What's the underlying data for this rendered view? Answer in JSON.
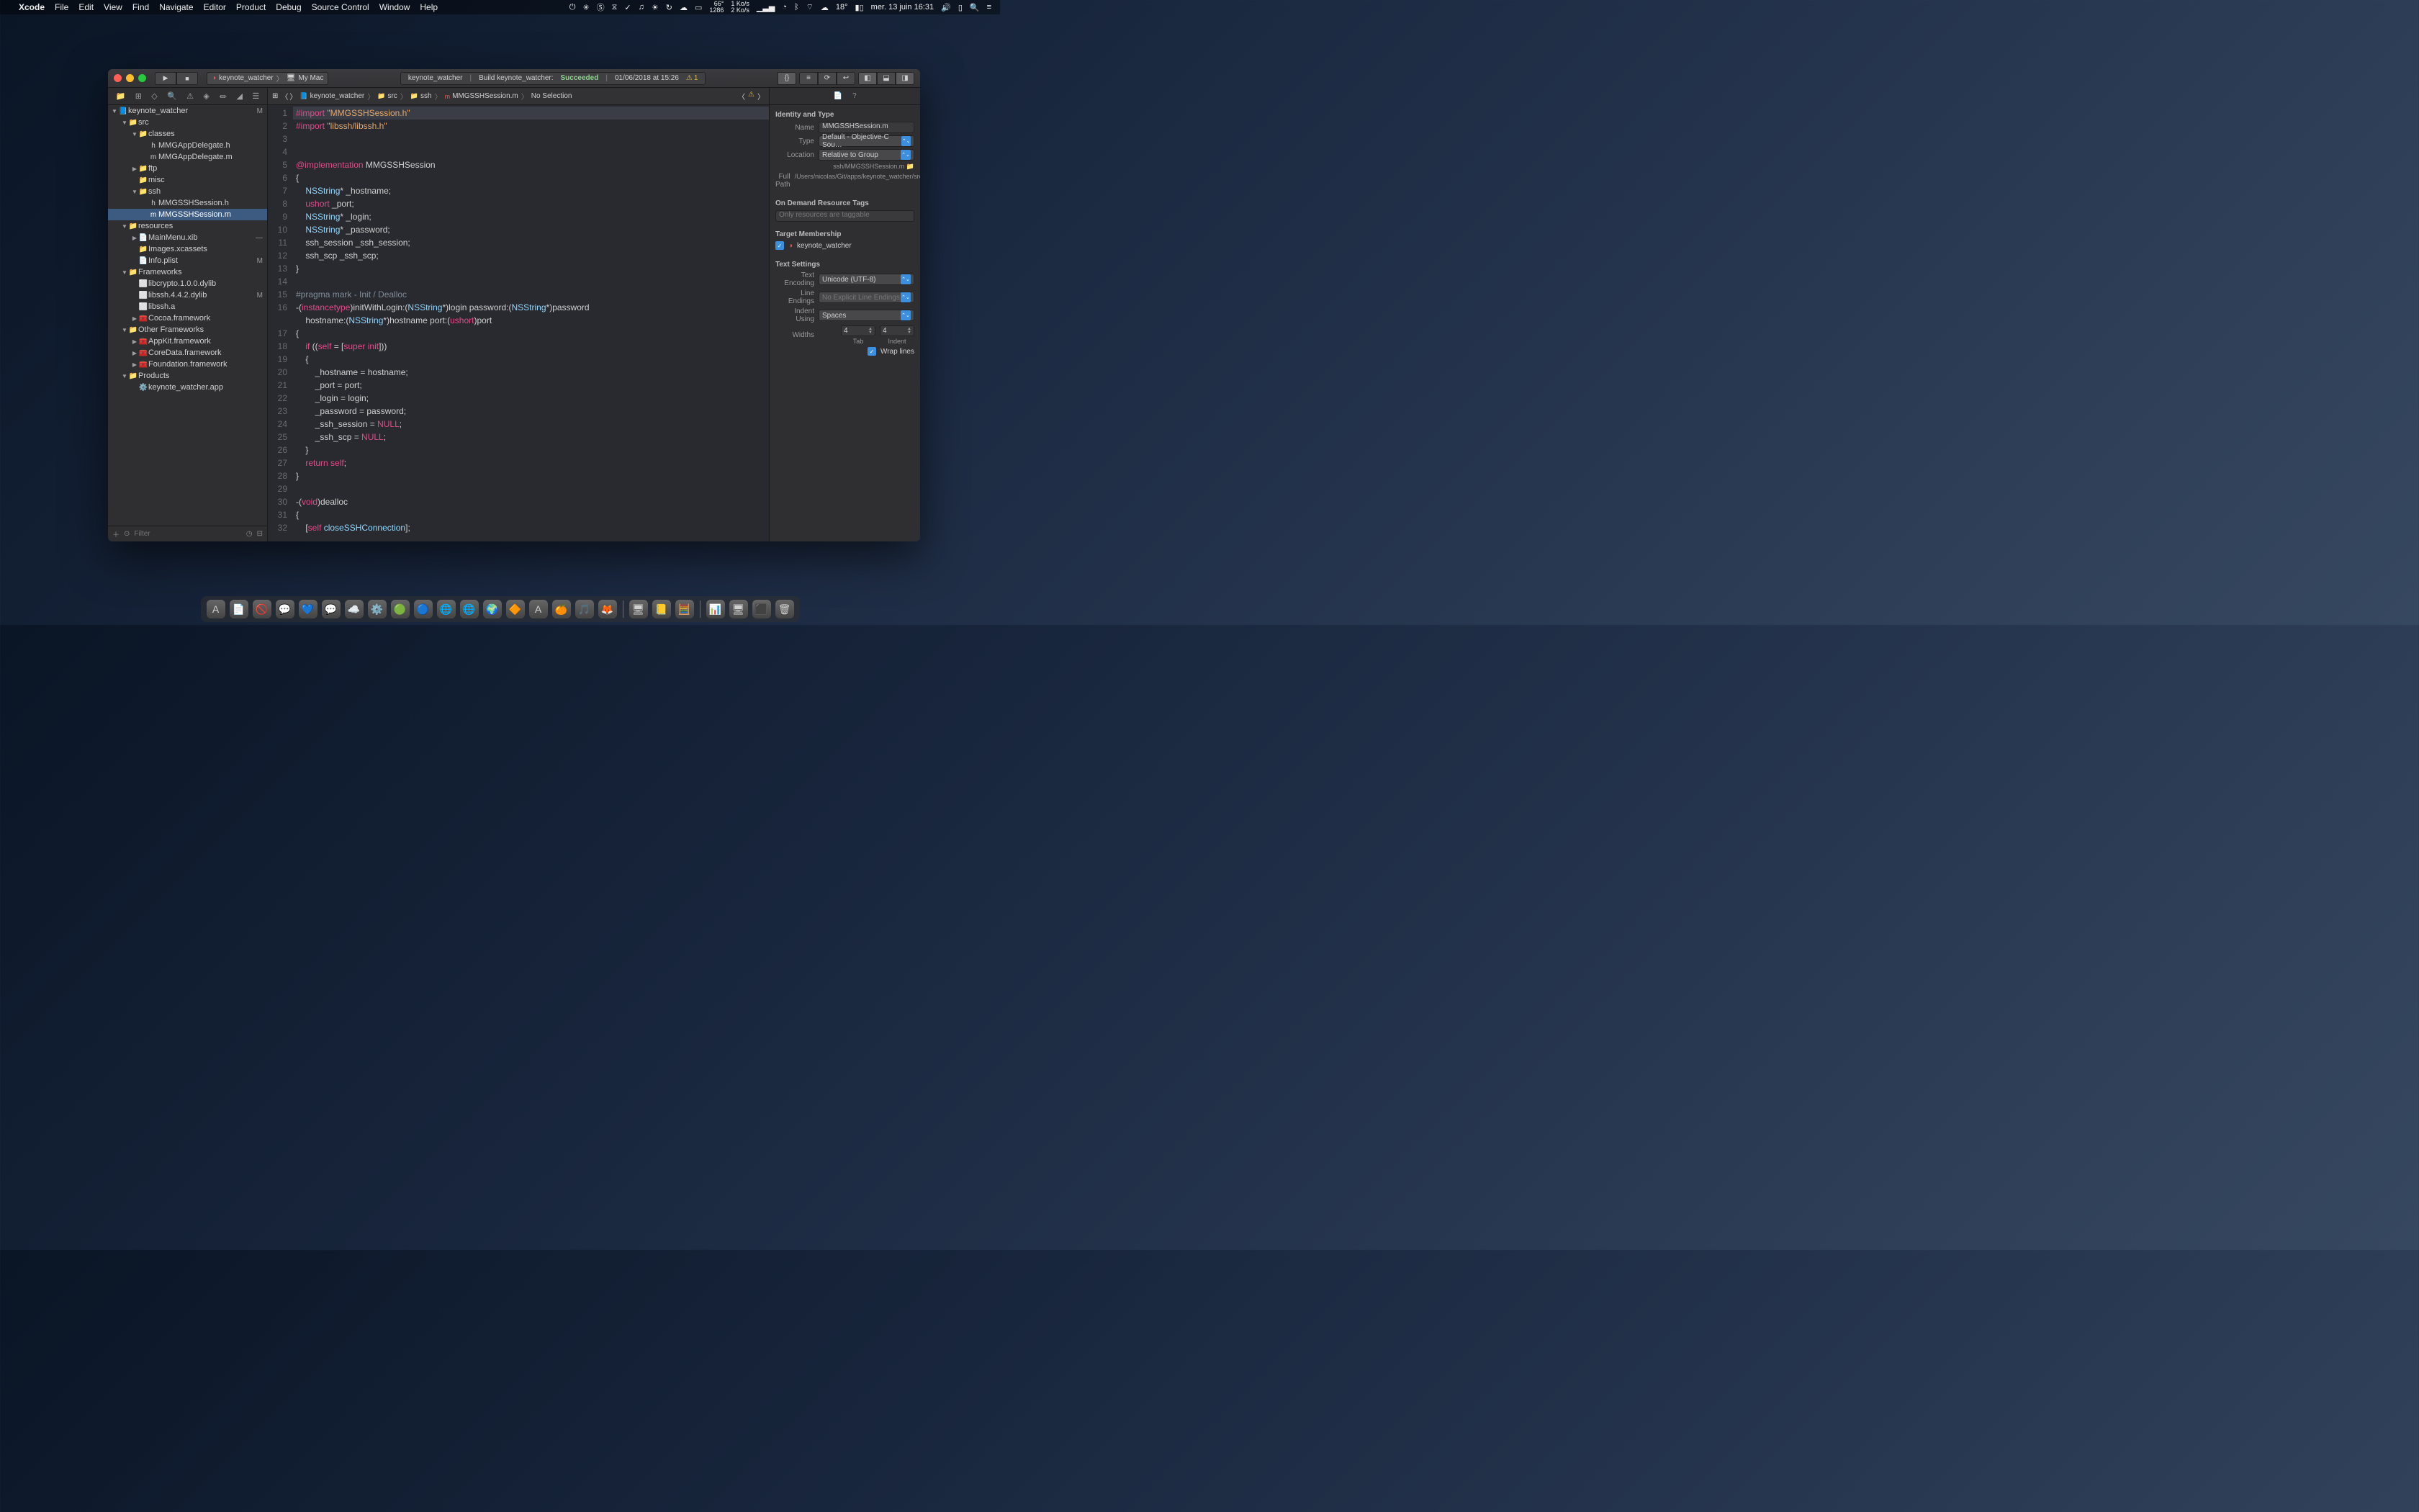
{
  "menubar": {
    "apple": "",
    "app": "Xcode",
    "items": [
      "File",
      "Edit",
      "View",
      "Find",
      "Navigate",
      "Editor",
      "Product",
      "Debug",
      "Source Control",
      "Window",
      "Help"
    ],
    "right": {
      "net_up": "1 Ko/s",
      "net_dn": "2 Ko/s",
      "fan_pct": "66°",
      "fan_rpm": "1286",
      "temp": "18°",
      "date": "mer. 13 juin 16:31"
    }
  },
  "toolbar": {
    "scheme_target": "keynote_watcher",
    "scheme_dest": "My Mac",
    "activity_project": "keynote_watcher",
    "activity_text": "Build keynote_watcher:",
    "activity_status": "Succeeded",
    "activity_time": "01/06/2018 at 15:26",
    "warn_count": "1"
  },
  "navigator": {
    "filter_placeholder": "Filter",
    "tree": [
      {
        "d": 0,
        "disc": "▼",
        "ic": "📘",
        "t": "keynote_watcher",
        "s": "M"
      },
      {
        "d": 1,
        "disc": "▼",
        "ic": "📁",
        "t": "src"
      },
      {
        "d": 2,
        "disc": "▼",
        "ic": "📁",
        "t": "classes"
      },
      {
        "d": 3,
        "disc": "",
        "ic": "h",
        "t": "MMGAppDelegate.h"
      },
      {
        "d": 3,
        "disc": "",
        "ic": "m",
        "t": "MMGAppDelegate.m"
      },
      {
        "d": 2,
        "disc": "▶",
        "ic": "📁",
        "t": "ftp"
      },
      {
        "d": 2,
        "disc": "",
        "ic": "📁",
        "t": "misc"
      },
      {
        "d": 2,
        "disc": "▼",
        "ic": "📁",
        "t": "ssh"
      },
      {
        "d": 3,
        "disc": "",
        "ic": "h",
        "t": "MMGSSHSession.h"
      },
      {
        "d": 3,
        "disc": "",
        "ic": "m",
        "t": "MMGSSHSession.m",
        "sel": true
      },
      {
        "d": 1,
        "disc": "▼",
        "ic": "📁",
        "t": "resources"
      },
      {
        "d": 2,
        "disc": "▶",
        "ic": "📄",
        "t": "MainMenu.xib",
        "s": "—"
      },
      {
        "d": 2,
        "disc": "",
        "ic": "📁",
        "t": "Images.xcassets"
      },
      {
        "d": 2,
        "disc": "",
        "ic": "📄",
        "t": "Info.plist",
        "s": "M"
      },
      {
        "d": 1,
        "disc": "▼",
        "ic": "📁",
        "t": "Frameworks"
      },
      {
        "d": 2,
        "disc": "",
        "ic": "⬜",
        "t": "libcrypto.1.0.0.dylib"
      },
      {
        "d": 2,
        "disc": "",
        "ic": "⬜",
        "t": "libssh.4.4.2.dylib",
        "s": "M"
      },
      {
        "d": 2,
        "disc": "",
        "ic": "⬜",
        "t": "libssh.a"
      },
      {
        "d": 2,
        "disc": "▶",
        "ic": "🧰",
        "t": "Cocoa.framework"
      },
      {
        "d": 1,
        "disc": "▼",
        "ic": "📁",
        "t": "Other Frameworks"
      },
      {
        "d": 2,
        "disc": "▶",
        "ic": "🧰",
        "t": "AppKit.framework"
      },
      {
        "d": 2,
        "disc": "▶",
        "ic": "🧰",
        "t": "CoreData.framework"
      },
      {
        "d": 2,
        "disc": "▶",
        "ic": "🧰",
        "t": "Foundation.framework"
      },
      {
        "d": 1,
        "disc": "▼",
        "ic": "📁",
        "t": "Products"
      },
      {
        "d": 2,
        "disc": "",
        "ic": "⚙️",
        "t": "keynote_watcher.app"
      }
    ]
  },
  "jumpbar": {
    "crumbs": [
      "keynote_watcher",
      "src",
      "ssh",
      "MMGSSHSession.m",
      "No Selection"
    ]
  },
  "code": {
    "lines": [
      {
        "n": 1,
        "h": [
          [
            "kw",
            "#import "
          ],
          [
            "str",
            "\"MMGSSHSession.h\""
          ]
        ],
        "cur": true
      },
      {
        "n": 2,
        "h": [
          [
            "kw",
            "#import "
          ],
          [
            "str",
            "\"libssh/libssh.h\""
          ]
        ]
      },
      {
        "n": 3,
        "h": [
          [
            "",
            ""
          ]
        ]
      },
      {
        "n": 4,
        "h": [
          [
            "",
            ""
          ]
        ]
      },
      {
        "n": 5,
        "h": [
          [
            "kw",
            "@implementation"
          ],
          [
            "",
            " MMGSSHSession"
          ]
        ]
      },
      {
        "n": 6,
        "h": [
          [
            "",
            "{"
          ]
        ]
      },
      {
        "n": 7,
        "h": [
          [
            "",
            "    "
          ],
          [
            "type",
            "NSString"
          ],
          [
            "",
            "* _hostname;"
          ]
        ]
      },
      {
        "n": 8,
        "h": [
          [
            "",
            "    "
          ],
          [
            "kw",
            "ushort"
          ],
          [
            "",
            " _port;"
          ]
        ]
      },
      {
        "n": 9,
        "h": [
          [
            "",
            "    "
          ],
          [
            "type",
            "NSString"
          ],
          [
            "",
            "* _login;"
          ]
        ]
      },
      {
        "n": 10,
        "h": [
          [
            "",
            "    "
          ],
          [
            "type",
            "NSString"
          ],
          [
            "",
            "* _password;"
          ]
        ]
      },
      {
        "n": 11,
        "h": [
          [
            "",
            "    ssh_session _ssh_session;"
          ]
        ]
      },
      {
        "n": 12,
        "h": [
          [
            "",
            "    ssh_scp _ssh_scp;"
          ]
        ]
      },
      {
        "n": 13,
        "h": [
          [
            "",
            "}"
          ]
        ]
      },
      {
        "n": 14,
        "h": [
          [
            "",
            ""
          ]
        ]
      },
      {
        "n": 15,
        "h": [
          [
            "cm",
            "#pragma mark - Init / Dealloc"
          ]
        ]
      },
      {
        "n": 16,
        "h": [
          [
            "",
            "-("
          ],
          [
            "kw",
            "instancetype"
          ],
          [
            "",
            ")initWithLogin:("
          ],
          [
            "type",
            "NSString"
          ],
          [
            "",
            "*)login password:("
          ],
          [
            "type",
            "NSString"
          ],
          [
            "",
            "*)password"
          ]
        ]
      },
      {
        "n": "",
        "h": [
          [
            "",
            "    hostname:("
          ],
          [
            "type",
            "NSString"
          ],
          [
            "",
            "*)hostname port:("
          ],
          [
            "kw",
            "ushort"
          ],
          [
            "",
            ")port"
          ]
        ]
      },
      {
        "n": 17,
        "h": [
          [
            "",
            "{"
          ]
        ]
      },
      {
        "n": 18,
        "h": [
          [
            "",
            "    "
          ],
          [
            "kw",
            "if"
          ],
          [
            "",
            " (("
          ],
          [
            "self",
            "self"
          ],
          [
            "",
            " = ["
          ],
          [
            "kw",
            "super"
          ],
          [
            "",
            " "
          ],
          [
            "kw",
            "init"
          ],
          [
            "",
            "]))"
          ]
        ]
      },
      {
        "n": 19,
        "h": [
          [
            "",
            "    {"
          ]
        ]
      },
      {
        "n": 20,
        "h": [
          [
            "",
            "        _hostname = hostname;"
          ]
        ]
      },
      {
        "n": 21,
        "h": [
          [
            "",
            "        _port = port;"
          ]
        ]
      },
      {
        "n": 22,
        "h": [
          [
            "",
            "        _login = login;"
          ]
        ]
      },
      {
        "n": 23,
        "h": [
          [
            "",
            "        _password = password;"
          ]
        ]
      },
      {
        "n": 24,
        "h": [
          [
            "",
            "        _ssh_session = "
          ],
          [
            "null",
            "NULL"
          ],
          [
            "",
            ";"
          ]
        ]
      },
      {
        "n": 25,
        "h": [
          [
            "",
            "        _ssh_scp = "
          ],
          [
            "null",
            "NULL"
          ],
          [
            "",
            ";"
          ]
        ]
      },
      {
        "n": 26,
        "h": [
          [
            "",
            "    }"
          ]
        ]
      },
      {
        "n": 27,
        "h": [
          [
            "",
            "    "
          ],
          [
            "kw",
            "return"
          ],
          [
            "",
            " "
          ],
          [
            "self",
            "self"
          ],
          [
            "",
            ";"
          ]
        ]
      },
      {
        "n": 28,
        "h": [
          [
            "",
            "}"
          ]
        ]
      },
      {
        "n": 29,
        "h": [
          [
            "",
            ""
          ]
        ]
      },
      {
        "n": 30,
        "h": [
          [
            "",
            "-("
          ],
          [
            "kw",
            "void"
          ],
          [
            "",
            ")dealloc"
          ]
        ]
      },
      {
        "n": 31,
        "h": [
          [
            "",
            "{"
          ]
        ]
      },
      {
        "n": 32,
        "h": [
          [
            "",
            "    ["
          ],
          [
            "self",
            "self"
          ],
          [
            "",
            " "
          ],
          [
            "type",
            "closeSSHConnection"
          ],
          [
            "",
            "];"
          ]
        ]
      }
    ]
  },
  "inspector": {
    "identity_title": "Identity and Type",
    "name_label": "Name",
    "name_value": "MMGSSHSession.m",
    "type_label": "Type",
    "type_value": "Default - Objective-C Sou…",
    "loc_label": "Location",
    "loc_value": "Relative to Group",
    "loc_path": "ssh/MMGSSHSession.m",
    "fullpath_label": "Full Path",
    "fullpath_value": "/Users/nicolas/Git/apps/keynote_watcher/src/ssh/MMGSSHSession.m",
    "ondemand_title": "On Demand Resource Tags",
    "ondemand_placeholder": "Only resources are taggable",
    "target_title": "Target Membership",
    "target_value": "keynote_watcher",
    "text_title": "Text Settings",
    "enc_label": "Text Encoding",
    "enc_value": "Unicode (UTF-8)",
    "le_label": "Line Endings",
    "le_value": "No Explicit Line Endings",
    "indent_label": "Indent Using",
    "indent_value": "Spaces",
    "widths_label": "Widths",
    "tab_label": "Tab",
    "tab_value": "4",
    "indentw_label": "Indent",
    "indentw_value": "4",
    "wrap_label": "Wrap lines"
  },
  "dock_count": 26
}
